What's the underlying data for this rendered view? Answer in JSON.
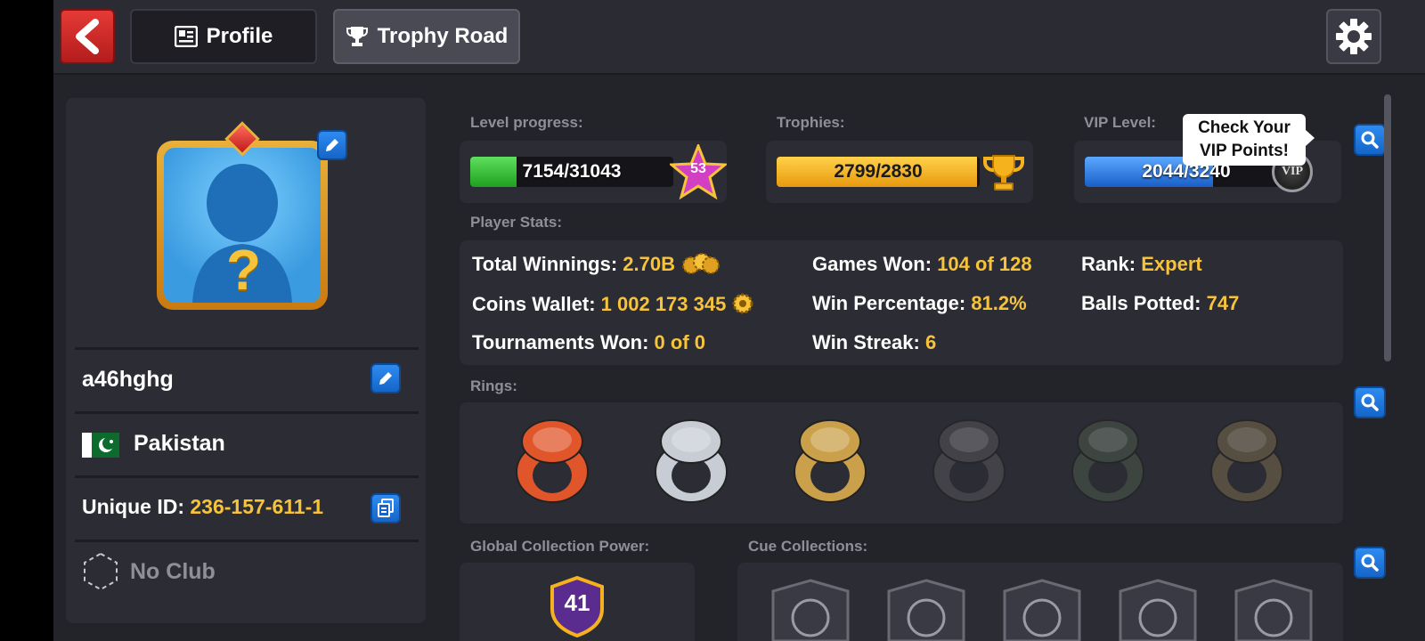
{
  "nav": {
    "back_icon": "back-arrow-icon",
    "tabs": [
      {
        "label": "Profile",
        "icon": "profile-card-icon",
        "active": false
      },
      {
        "label": "Trophy Road",
        "icon": "trophy-icon",
        "active": true
      }
    ],
    "settings_icon": "gear-icon"
  },
  "profile": {
    "username": "a46hghg",
    "country": "Pakistan",
    "unique_id_label": "Unique ID:",
    "unique_id": "236-157-611-1",
    "club": "No Club",
    "avatar_placeholder": "?"
  },
  "progress": {
    "level_label": "Level progress:",
    "level_value": "7154/31043",
    "level_fraction": 0.23,
    "level_number": "53",
    "trophies_label": "Trophies:",
    "trophies_value": "2799/2830",
    "trophies_fraction": 0.989,
    "vip_label": "VIP Level:",
    "vip_value": "2044/3240",
    "vip_fraction": 0.631,
    "vip_badge": "VIP",
    "tooltip": "Check Your VIP Points!"
  },
  "stats": {
    "section_label": "Player Stats:",
    "total_winnings_label": "Total Winnings:",
    "total_winnings": "2.70B",
    "coins_wallet_label": "Coins Wallet:",
    "coins_wallet": "1 002 173 345",
    "tournaments_won_label": "Tournaments Won:",
    "tournaments_won": "0 of 0",
    "games_won_label": "Games Won:",
    "games_won": "104 of 128",
    "win_percentage_label": "Win Percentage:",
    "win_percentage": "81.2%",
    "win_streak_label": "Win Streak:",
    "win_streak": "6",
    "rank_label": "Rank:",
    "rank": "Expert",
    "balls_potted_label": "Balls Potted:",
    "balls_potted": "747"
  },
  "rings": {
    "section_label": "Rings:",
    "items": [
      {
        "name": "ring-1",
        "color": "#e0562a",
        "owned": true
      },
      {
        "name": "ring-2",
        "color": "#c8ccd4",
        "owned": true
      },
      {
        "name": "ring-3",
        "color": "#caa04a",
        "owned": true
      },
      {
        "name": "ring-4",
        "color": "#55555a",
        "owned": false
      },
      {
        "name": "ring-5",
        "color": "#4a5a4a",
        "owned": false
      },
      {
        "name": "ring-6",
        "color": "#7a6a4a",
        "owned": false
      }
    ]
  },
  "collection": {
    "power_label": "Global Collection Power:",
    "power_value": "41",
    "cue_label": "Cue Collections:",
    "cue_icons": [
      "horseshoe-icon",
      "fireworks-icon",
      "eight-ball-icon",
      "city-skyline-icon",
      "diamond-icon"
    ]
  },
  "colors": {
    "accent_yellow": "#f6c33b",
    "panel": "#2c2c34",
    "background": "#23232a",
    "level_bar": "#2ec02e",
    "trophy_bar": "#f6b21c",
    "vip_bar": "#2f7de0"
  }
}
